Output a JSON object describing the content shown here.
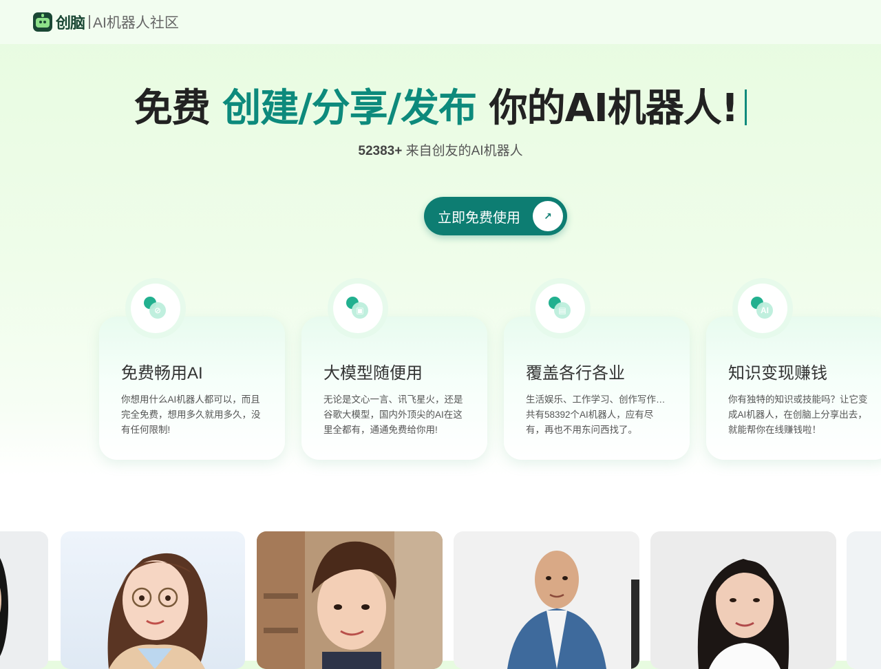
{
  "header": {
    "brand": "创脑",
    "community": "AI机器人社区"
  },
  "hero": {
    "title_prefix": "免费",
    "title_accent": "创建/分享/发布",
    "title_suffix": "你的AI机器人!",
    "count": "52383+",
    "subtitle": "来自创友的AI机器人",
    "cta_label": "立即免费使用",
    "cta_icon": "arrow-up-right-icon"
  },
  "features": [
    {
      "title": "免费畅用AI",
      "desc": "你想用什么AI机器人都可以，而且完全免费，想用多久就用多久，没有任何限制!",
      "icon": "free-icon"
    },
    {
      "title": "大模型随便用",
      "desc": "无论是文心一言、讯飞星火，还是谷歌大模型，国内外顶尖的AI在这里全都有，通通免费给你用!",
      "icon": "model-icon"
    },
    {
      "title": "覆盖各行各业",
      "desc": "生活娱乐、工作学习、创作写作…共有58392个AI机器人，应有尽有，再也不用东问西找了。",
      "icon": "industry-icon"
    },
    {
      "title": "知识变现赚钱",
      "desc": "你有独特的知识或技能吗？让它变成AI机器人，在创脑上分享出去，就能帮你在线赚钱啦！",
      "icon": "ai-money-icon"
    }
  ],
  "colors": {
    "accent": "#0d8a7c",
    "button": "#0d7d72",
    "brand_dark": "#1a4734"
  }
}
